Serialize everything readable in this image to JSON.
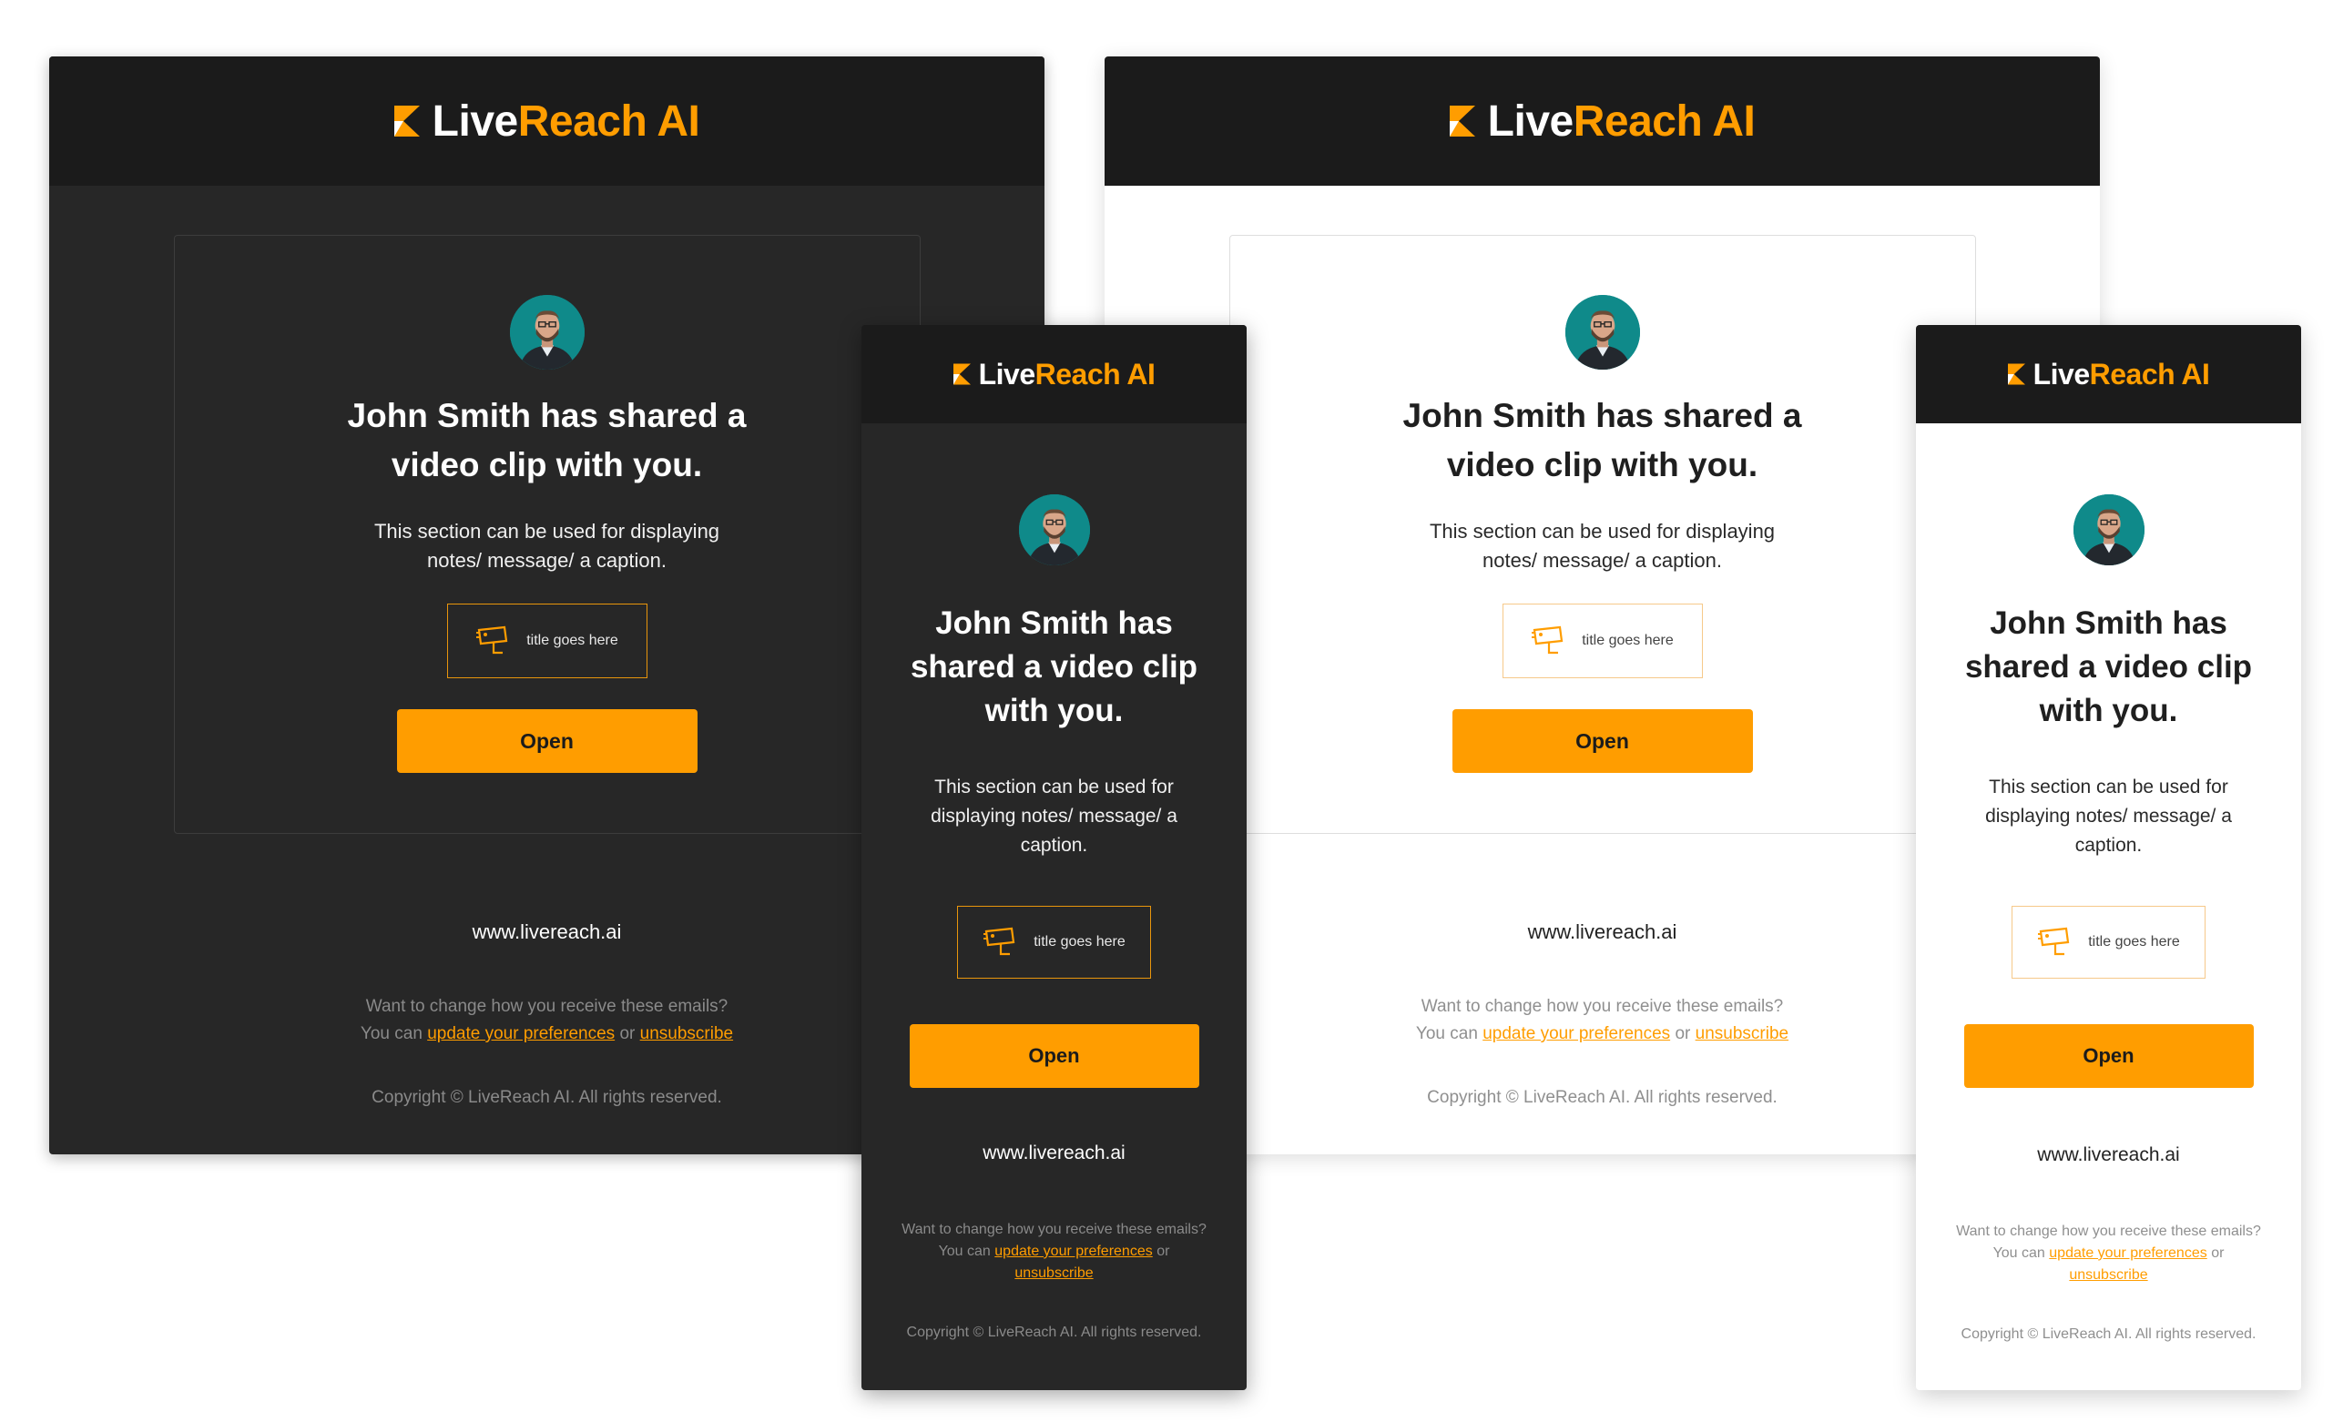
{
  "brand": {
    "name_part1": "Live",
    "name_part2": "Reach AI"
  },
  "email": {
    "headline": "John Smith has shared a video clip with you.",
    "message": "This section can be used for displaying notes/ message/ a caption.",
    "clip_title": "title goes here",
    "button_label": "Open"
  },
  "footer": {
    "site": "www.livereach.ai",
    "pref_line1": "Want to change how you receive these emails?",
    "pref_you_can": "You can",
    "pref_update_link": "update your preferences",
    "pref_or": "or",
    "pref_unsub_link": "unsubscribe",
    "copyright": "Copyright ©  LiveReach AI. All rights reserved."
  },
  "colors": {
    "accent": "#ff9d00",
    "dark_header": "#1b1b1b",
    "dark_body": "#272727",
    "light_body": "#ffffff",
    "avatar_bg": "#0f8a8a"
  },
  "icons": {
    "logo": "livereach-logo-mark",
    "clip": "video-camera-icon",
    "avatar": "user-avatar"
  }
}
